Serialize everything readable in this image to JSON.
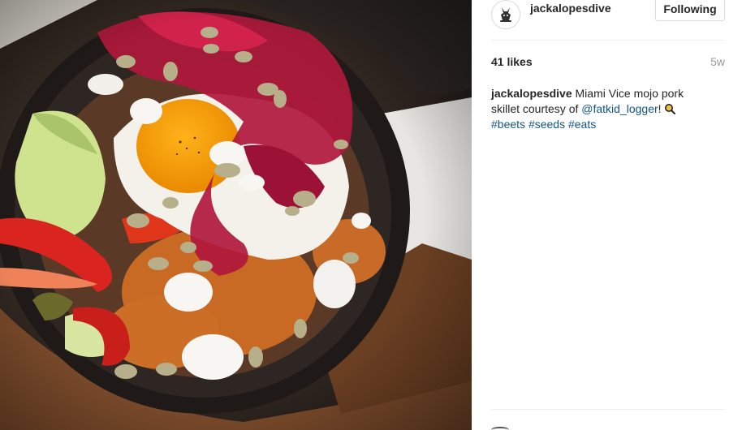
{
  "post": {
    "username": "jackalopesdive",
    "follow_label": "Following",
    "likes": "41 likes",
    "age": "5w",
    "caption": {
      "user": "jackalopesdive",
      "text_before_mention": " Miami Vice mojo pork skillet courtesy of ",
      "mention": "@fatkid_logger",
      "text_after_mention": "! ",
      "hashtags": [
        "#beets",
        "#seeds",
        "#eats"
      ]
    }
  },
  "icons": {
    "avatar": "jackalope-logo-icon",
    "caption_emoji": "magnifying-glass-icon",
    "footer": "heart-icon"
  },
  "colors": {
    "link": "#125688",
    "text": "#262626",
    "muted": "#999999",
    "border": "#dbdbdb"
  }
}
